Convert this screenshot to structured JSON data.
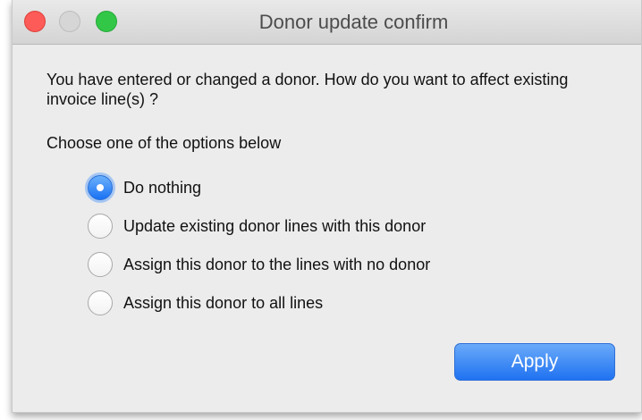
{
  "window": {
    "title": "Donor update confirm"
  },
  "dialog": {
    "message": "You have entered or changed a donor. How do you want to affect existing invoice line(s) ?",
    "prompt": "Choose one of the options below",
    "options": [
      {
        "label": "Do nothing",
        "selected": true
      },
      {
        "label": "Update existing donor lines with this donor",
        "selected": false
      },
      {
        "label": "Assign this donor to the lines with no donor",
        "selected": false
      },
      {
        "label": "Assign this donor to all lines",
        "selected": false
      }
    ],
    "apply_label": "Apply"
  },
  "colors": {
    "accent": "#1f72f1",
    "close": "#fc5b57",
    "minimize": "#d6d6d6",
    "zoom": "#33c748"
  }
}
